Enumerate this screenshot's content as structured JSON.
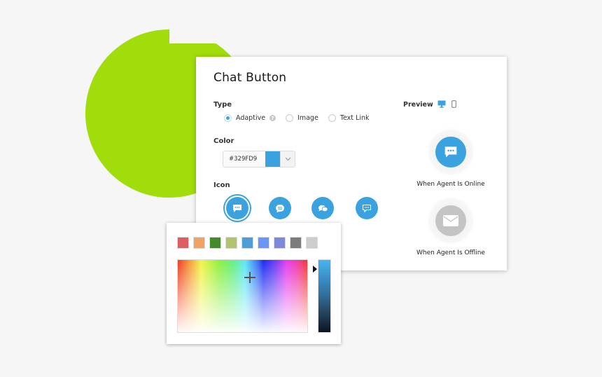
{
  "card": {
    "title": "Chat Button",
    "type_label": "Type",
    "type_options": [
      {
        "label": "Adaptive",
        "checked": true,
        "help": "?"
      },
      {
        "label": "Image",
        "checked": false
      },
      {
        "label": "Text Link",
        "checked": false
      }
    ],
    "color_label": "Color",
    "color_value": "#329FD9",
    "color_swatch": "#3aa3df",
    "icon_label": "Icon",
    "icons": [
      {
        "name": "chat-bubble-dots-icon",
        "selected": true
      },
      {
        "name": "chat-bubble-lines-icon",
        "selected": false
      },
      {
        "name": "chat-bubbles-double-icon",
        "selected": false
      },
      {
        "name": "chat-bubble-outline-icon",
        "selected": false
      }
    ],
    "preview_label": "Preview",
    "preview_devices": [
      "desktop-icon",
      "mobile-icon"
    ],
    "online_caption": "When Agent Is Online",
    "offline_caption": "When Agent Is Offline",
    "online_color": "#3aa3df",
    "offline_color": "#c4c4c4"
  },
  "picker": {
    "presets": [
      "#dd5f5f",
      "#f2a262",
      "#438a28",
      "#b0c46e",
      "#4f9dd6",
      "#6897f7",
      "#7f89d8",
      "#7c7c7c",
      "#cdcdcd"
    ]
  },
  "colors": {
    "accent": "#3aa3df",
    "blob": "#a0dd0a"
  }
}
